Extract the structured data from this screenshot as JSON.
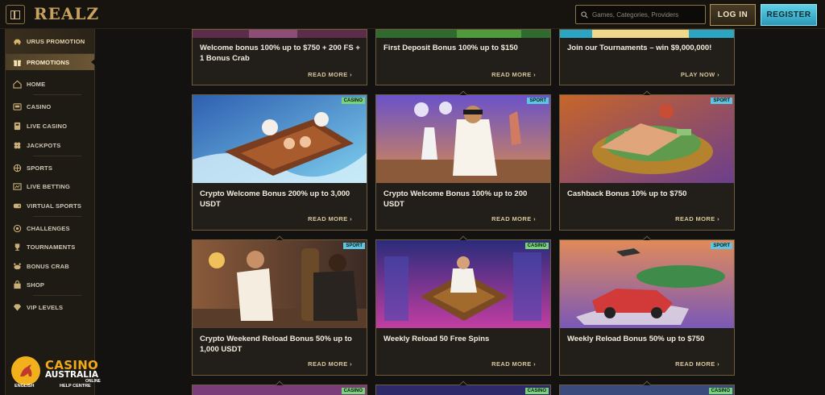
{
  "header": {
    "logo": "REALZ",
    "search_placeholder": "Games, Categories, Providers",
    "login_label": "LOG IN",
    "register_label": "REGISTER"
  },
  "sidebar": {
    "top_promo": "URUS PROMOTION",
    "active_item": "PROMOTIONS",
    "items": [
      {
        "label": "HOME",
        "icon": "home-icon"
      },
      {
        "label": "CASINO",
        "icon": "casino-icon"
      },
      {
        "label": "LIVE CASINO",
        "icon": "live-casino-icon"
      },
      {
        "label": "JACKPOTS",
        "icon": "clover-icon"
      },
      {
        "label": "SPORTS",
        "icon": "ball-icon"
      },
      {
        "label": "LIVE BETTING",
        "icon": "live-betting-icon"
      },
      {
        "label": "VIRTUAL SPORTS",
        "icon": "virtual-sports-icon"
      },
      {
        "label": "CHALLENGES",
        "icon": "challenges-icon"
      },
      {
        "label": "TOURNAMENTS",
        "icon": "trophy-icon"
      },
      {
        "label": "BONUS CRAB",
        "icon": "crab-icon"
      },
      {
        "label": "SHOP",
        "icon": "shop-icon"
      },
      {
        "label": "VIP LEVELS",
        "icon": "diamond-icon"
      }
    ]
  },
  "footer_badge": {
    "casino": "CASINO",
    "australia": "AUSTRALIA",
    "online": "ONLINE",
    "english": "ENGLISH",
    "help": "HELP CENTRE"
  },
  "cards": {
    "row0": [
      {
        "title": "Welcome bonus 100% up to $750 + 200 FS + 1 Bonus Crab",
        "action": "READ MORE"
      },
      {
        "title": "First Deposit Bonus 100% up to $150",
        "action": "READ MORE"
      },
      {
        "title": "Join our Tournaments – win $9,000,000!",
        "action": "PLAY NOW"
      }
    ],
    "row1": [
      {
        "title": "Crypto Welcome Bonus 200% up to 3,000 USDT",
        "action": "READ MORE",
        "tag": "CASINO"
      },
      {
        "title": "Crypto Welcome Bonus 100% up to 200 USDT",
        "action": "READ MORE",
        "tag": "SPORT"
      },
      {
        "title": "Cashback Bonus 10% up to $750",
        "action": "READ MORE",
        "tag": "SPORT"
      }
    ],
    "row2": [
      {
        "title": "Crypto Weekend Reload Bonus 50% up to 1,000 USDT",
        "action": "READ MORE",
        "tag": "SPORT"
      },
      {
        "title": "Weekly Reload 50 Free Spins",
        "action": "READ MORE",
        "tag": "CASINO"
      },
      {
        "title": "Weekly Reload Bonus 50% up to $750",
        "action": "READ MORE",
        "tag": "SPORT"
      }
    ],
    "row3": [
      {
        "tag": "CASINO"
      },
      {
        "tag": "CASINO"
      },
      {
        "tag": "CASINO"
      }
    ]
  }
}
